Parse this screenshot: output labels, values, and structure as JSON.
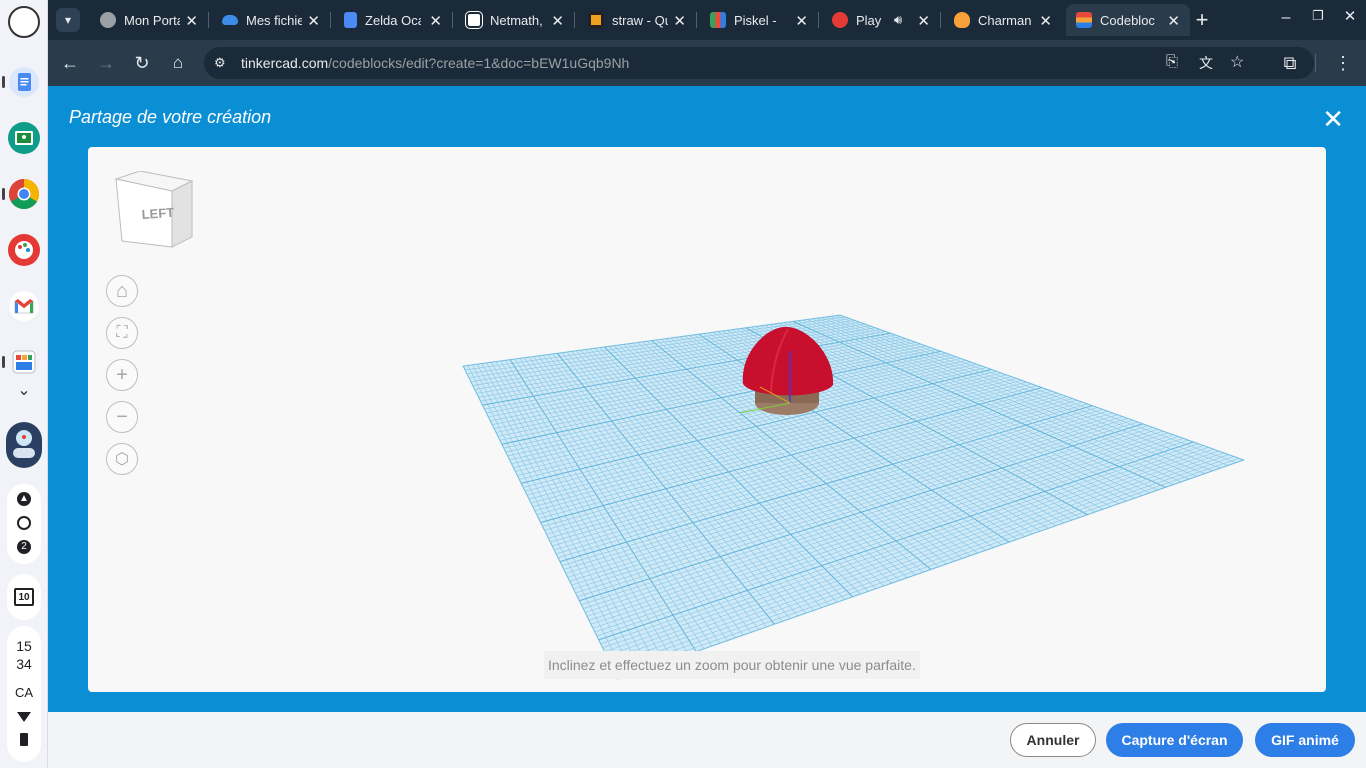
{
  "shelf": {
    "apps": [
      "docs-icon",
      "classroom-icon",
      "chrome-icon",
      "paint-icon",
      "gmail-icon",
      "codeblocks-app-icon"
    ],
    "notification_count": "2",
    "calendar_day": "10",
    "clock_hours": "15",
    "clock_minutes": "34",
    "locale": "CA"
  },
  "tabs": [
    {
      "title": "Mon Porta",
      "icon": "globe-icon",
      "color": "#9aa0a6"
    },
    {
      "title": "Mes fichie",
      "icon": "onedrive-icon",
      "color": "#3b8de8"
    },
    {
      "title": "Zelda Oca",
      "icon": "docs-icon",
      "color": "#4a8af4"
    },
    {
      "title": "Netmath,",
      "icon": "netmath-icon",
      "color": "#ffffff"
    },
    {
      "title": "straw - Qu",
      "icon": "quizlet-icon",
      "color": "#f0a020"
    },
    {
      "title": "Piskel -",
      "icon": "piskel-icon",
      "color": "#3aa05a"
    },
    {
      "title": "Play I",
      "icon": "play-icon",
      "color": "#e53935"
    },
    {
      "title": "Charman",
      "icon": "charmander-icon",
      "color": "#f6a13a"
    },
    {
      "title": "Codebloc",
      "icon": "tinkercad-icon",
      "color": "#e84a3a"
    }
  ],
  "address": {
    "host": "tinkercad.com",
    "path": "/codeblocks/edit?create=1&doc=bEW1uGqb9Nh"
  },
  "dialog": {
    "title": "Partage de votre création",
    "view_cube_label": "LEFT",
    "hint": "Inclinez et effectuez un zoom pour obtenir une vue parfaite.",
    "buttons": {
      "cancel": "Annuler",
      "screenshot": "Capture d'écran",
      "gif": "GIF animé"
    }
  },
  "colors": {
    "dialog_bg": "#0a8fd4",
    "primary_button": "#2d7ee6",
    "model_red": "#c8102e",
    "grid_blue": "#a9d8ef"
  }
}
